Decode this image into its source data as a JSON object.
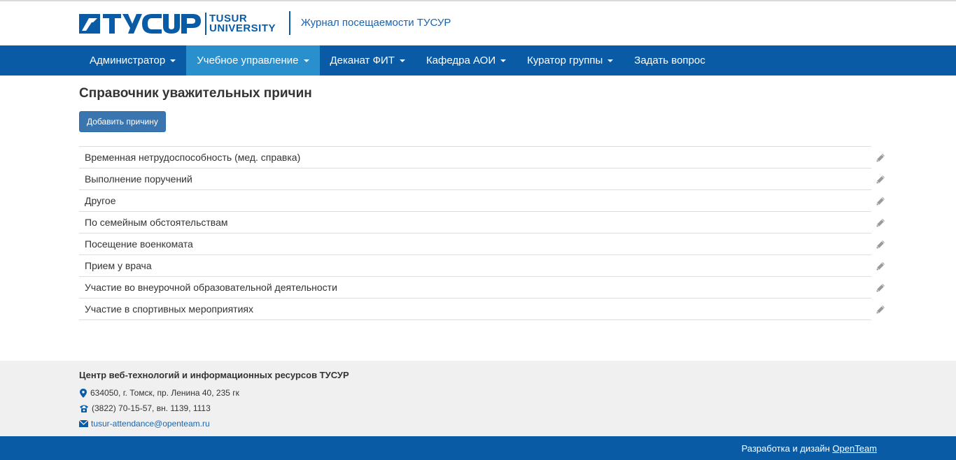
{
  "header": {
    "logo_text_line1": "TUSUR",
    "logo_text_line2": "UNIVERSITY",
    "site_title": "Журнал посещаемости ТУСУР"
  },
  "nav": {
    "items": [
      {
        "label": "Администратор",
        "dropdown": true,
        "active": false
      },
      {
        "label": "Учебное управление",
        "dropdown": true,
        "active": true
      },
      {
        "label": "Деканат ФИТ",
        "dropdown": true,
        "active": false
      },
      {
        "label": "Кафедра АОИ",
        "dropdown": true,
        "active": false
      },
      {
        "label": "Куратор группы",
        "dropdown": true,
        "active": false
      },
      {
        "label": "Задать вопрос",
        "dropdown": false,
        "active": false
      }
    ]
  },
  "main": {
    "title": "Справочник уважительных причин",
    "add_button": "Добавить причину",
    "reasons": [
      "Временная нетрудоспособность (мед. справка)",
      "Выполнение поручений",
      "Другое",
      "По семейным обстоятельствам",
      "Посещение военкомата",
      "Прием у врача",
      "Участие во внеурочной образовательной деятельности",
      "Участие в спортивных мероприятиях"
    ],
    "edit_icon": "pencil-icon"
  },
  "footer": {
    "org": "Центр веб-технологий и информационных ресурсов ТУСУР",
    "address": "634050, г. Томск, пр. Ленина 40, 235 гк",
    "phone": "(3822) 70-15-57, вн. 1139, 1113",
    "email": "tusur-attendance@openteam.ru",
    "credits_prefix": "Разработка и дизайн",
    "credits_link": "OpenTeam"
  },
  "colors": {
    "brand": "#0a5ba6",
    "nav_active": "#2a8fcd",
    "button": "#3a75b0"
  }
}
